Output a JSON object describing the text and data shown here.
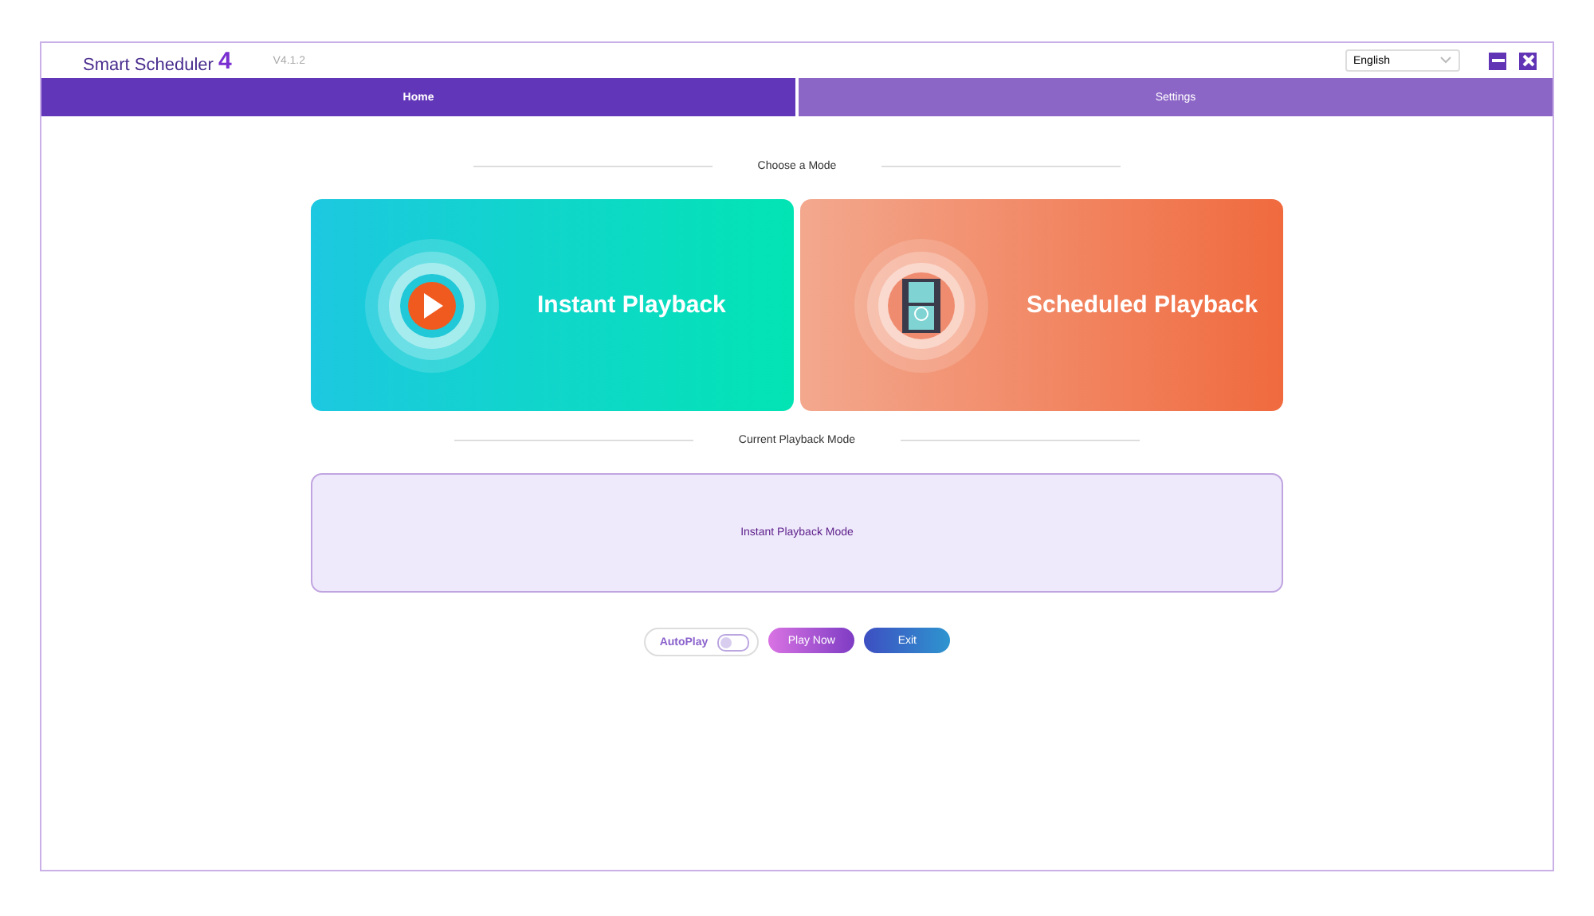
{
  "header": {
    "logo": {
      "word": "Smart Scheduler",
      "edition": "4"
    },
    "version": "V4.1.2",
    "language": "English"
  },
  "tabs": [
    {
      "label": "Home",
      "selected": true
    },
    {
      "label": "Settings",
      "selected": false
    }
  ],
  "mode_heading": "Choose a Mode",
  "modes": [
    {
      "kind": "instant",
      "label": "Instant Playback"
    },
    {
      "kind": "scheduled",
      "label": "Scheduled Playback"
    }
  ],
  "current_heading": "Current Playback Mode",
  "current_mode": "Instant Playback Mode",
  "controls": {
    "autoplay": {
      "label": "AutoPlay",
      "on": false
    },
    "play_button": "Play Now",
    "exit_button": "Exit"
  }
}
